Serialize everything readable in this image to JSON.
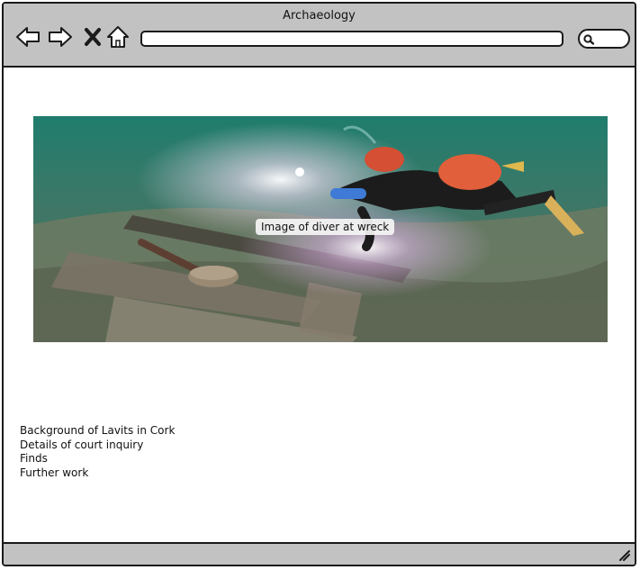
{
  "window": {
    "title": "Archaeology"
  },
  "toolbar": {
    "back_icon": "back-arrow-icon",
    "forward_icon": "forward-arrow-icon",
    "stop_icon": "close-icon",
    "home_icon": "home-icon",
    "search_icon": "search-icon",
    "address_value": ""
  },
  "hero": {
    "caption": "Image of diver at wreck"
  },
  "links": [
    "Background of Lavits in Cork",
    "Details of court inquiry",
    "Finds",
    "Further work"
  ],
  "colors": {
    "chrome": "#c2c2c2",
    "border": "#1a1a1a",
    "water": "#2f6a5e"
  }
}
